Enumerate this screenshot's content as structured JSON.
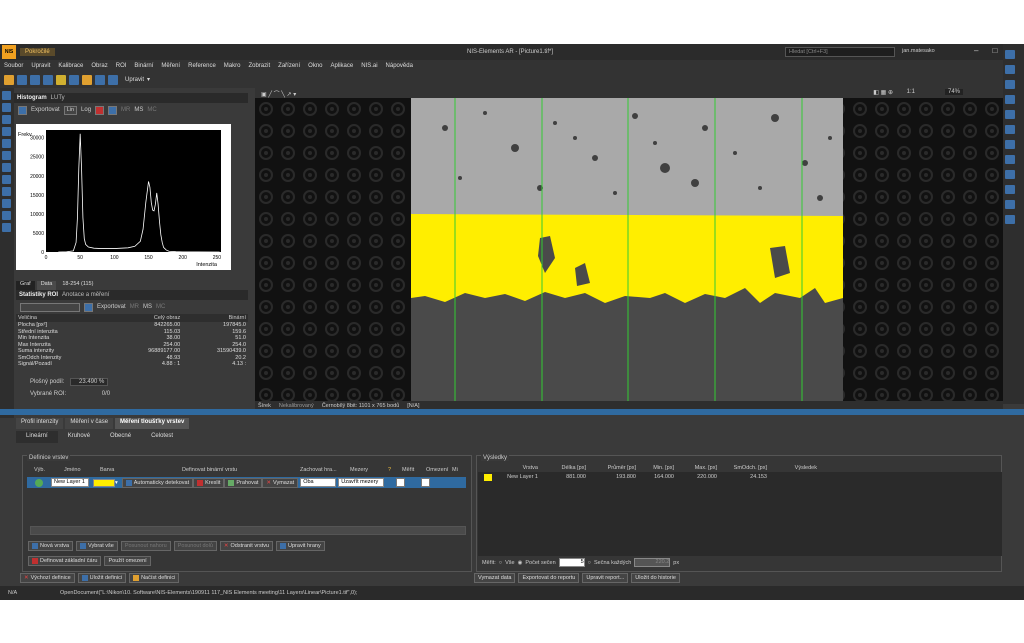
{
  "window": {
    "app_tab": "Pokročilé",
    "title": "NIS-Elements AR - [Picture1.tif*]",
    "search_placeholder": "Hledat [Ctrl+F3]",
    "user": "jan.matesako",
    "logo": "NIS"
  },
  "menu": [
    "Soubor",
    "Upravit",
    "Kalibrace",
    "Obraz",
    "ROI",
    "Binární",
    "Měření",
    "Reference",
    "Makro",
    "Zobrazit",
    "Zařízení",
    "Okno",
    "Aplikace",
    "NIS.ai",
    "Nápověda"
  ],
  "toolbar": {
    "edit_label": "Upravit"
  },
  "histogram": {
    "title": "Histogram",
    "tab2": "LUTy",
    "export_label": "Exportovat",
    "lin": "Lin",
    "log": "Log",
    "mr": "MR",
    "ms": "MS",
    "mc": "MC",
    "ylabel": "Frekv.",
    "xlabel": "Intenzita",
    "tabs": [
      "Graf",
      "Data"
    ],
    "range": "18-254 (115)",
    "chart_data": {
      "type": "line",
      "title": "",
      "xlabel": "Intenzita",
      "ylabel": "Frekv.",
      "xlim": [
        0,
        256
      ],
      "ylim": [
        0,
        32000
      ],
      "xticks": [
        0,
        50,
        100,
        150,
        200,
        250
      ],
      "yticks": [
        0,
        2500,
        5000,
        7500,
        10000,
        12500,
        15000,
        17500,
        20000,
        22500,
        25000,
        27500,
        30000
      ],
      "series": [
        {
          "x": [
            18,
            30,
            40,
            44,
            46,
            48,
            50,
            52,
            54,
            56,
            58,
            62,
            70,
            80,
            90,
            100,
            110,
            120,
            130,
            138,
            142,
            146,
            150,
            152,
            154,
            156,
            158,
            160,
            162,
            164,
            166,
            168,
            170,
            172,
            176,
            180,
            190,
            200,
            220,
            254
          ],
          "y": [
            0,
            50,
            300,
            2500,
            9000,
            22000,
            31000,
            22000,
            9000,
            3500,
            2000,
            1300,
            1000,
            900,
            900,
            900,
            1000,
            1100,
            1500,
            2800,
            6000,
            13000,
            18500,
            17000,
            13000,
            11000,
            10800,
            12500,
            15500,
            12500,
            8000,
            4500,
            2500,
            1200,
            500,
            200,
            80,
            40,
            10,
            0
          ]
        }
      ]
    }
  },
  "stats": {
    "title": "Statistiky ROI",
    "tab2": "Anotace a měření",
    "export_label": "Exportovat",
    "mr": "MR",
    "ms": "MS",
    "mc": "MC",
    "columns": [
      "Veličina",
      "Celý obraz",
      "Binární"
    ],
    "rows": [
      [
        "Plocha [px²]",
        "842265.00",
        "197845.0"
      ],
      [
        "Střední intenzita",
        "115.03",
        "159.6"
      ],
      [
        "Min Intenzita",
        "38.00",
        "51.0"
      ],
      [
        "Max Intenzita",
        "254.00",
        "254.0"
      ],
      [
        "Suma intenzity",
        "96889177.00",
        "31590439.0"
      ],
      [
        "SmOdch Intenzity",
        "48.93",
        "20.2"
      ],
      [
        "Signál/Pozadí",
        "4.88 : 1",
        "4.13 :"
      ]
    ],
    "area_label": "Plošný podíl:",
    "area_value": "23.490 %",
    "roi_label": "Vybrané ROI:",
    "roi_value": "0/0"
  },
  "image": {
    "zoom": "74%",
    "scale_label": "1:1",
    "status": [
      "Šírek",
      "Nekalibrovaný",
      "Černobílý 8bit: 1101 x 765 bodů",
      "[N/A]"
    ]
  },
  "bottom_tabs": [
    "Profil intenzity",
    "Měření v čase",
    "Měření tloušťky vrstev"
  ],
  "sub_tabs": [
    "Lineární",
    "Kruhové",
    "Obecné",
    "Celotest"
  ],
  "defs": {
    "title": "Definice vrstev",
    "headers": [
      "Výb.",
      "Jméno",
      "Barva",
      "Definovat binární vrstu",
      "Zachovat hra...",
      "Mezery",
      "?",
      "Měřit",
      "Omezení",
      "Mi"
    ],
    "layer": {
      "name": "New Layer 1",
      "color": "#ffee00",
      "auto_label": "Automaticky detekovat",
      "draw_label": "Kreslit",
      "thresh_label": "Prahovat",
      "delete_label": "Vymazat",
      "keep": "Oba",
      "gaps": "Uzavřít mezery"
    },
    "buttons": [
      "Nová vrstva",
      "Vybrat vše",
      "Posunout nahoru",
      "Posunout dolů",
      "Odstranit vrstvu",
      "Upravit hrany"
    ],
    "buttons2": [
      "Definovat základní čáru",
      "Použít omezení"
    ],
    "buttons3": [
      "Výchozí definice",
      "Uložit definici",
      "Načíst definici"
    ]
  },
  "results": {
    "title": "Výsledky",
    "headers": [
      "Vrstva",
      "Délka [px]",
      "Průměr [px]",
      "Min. [px]",
      "Max. [px]",
      "SmOdch. [px]",
      "Výsledek"
    ],
    "rows": [
      [
        "New Layer 1",
        "881.000",
        "193.800",
        "164.000",
        "220.000",
        "24.153",
        ""
      ]
    ],
    "measure_label": "Měřit:",
    "all_label": "Vše",
    "count_label": "Počet sečen",
    "count_value": "5",
    "each_label": "Sečna každých",
    "each_value": "220.2",
    "each_unit": "px",
    "buttons": [
      "Vymazat data",
      "Exportovat do reportu",
      "Upravit report...",
      "Uložit do historie"
    ]
  },
  "statusbar": {
    "left": "N/A",
    "path": "OpenDocument(\"L:\\Nikon\\10. Software\\NIS-Elements\\190911 117_NIS Elements meeting\\11 Layers\\Linear\\Picture1.tif\",0);"
  },
  "colors": {
    "accent": "#2f6aa0",
    "layer": "#ffee00",
    "grid": "#33cc33",
    "bg": "#3a3a3a"
  }
}
